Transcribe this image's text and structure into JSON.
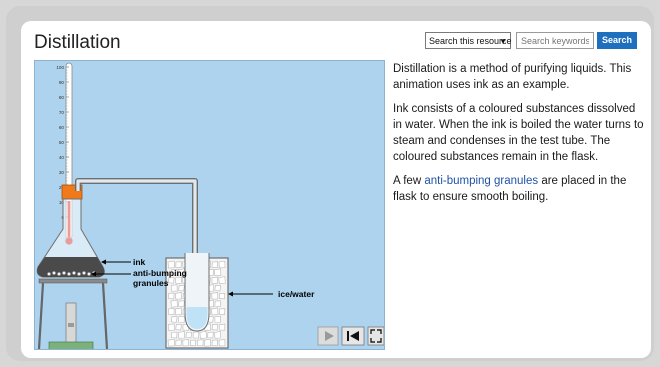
{
  "page": {
    "title": "Distillation"
  },
  "search": {
    "scope_label": "Search this resource",
    "placeholder": "Search keywords...",
    "button_label": "Search"
  },
  "animation": {
    "thermometer_ticks": [
      "100",
      "90",
      "80",
      "70",
      "60",
      "50",
      "40",
      "30",
      "20",
      "10",
      "0"
    ],
    "labels": {
      "ink": "ink",
      "granules_line1": "anti-bumping",
      "granules_line2": "granules",
      "ice_water": "ice/water"
    },
    "controls": [
      "play-icon",
      "rewind-icon",
      "fullscreen-icon"
    ]
  },
  "description": {
    "p1": "Distillation is a method of purifying liquids. This animation uses ink as an example.",
    "p2": "Ink consists of a coloured substances dissolved in water. When the ink is boiled the water turns to steam and condenses in the test tube. The coloured substances remain in the flask.",
    "p3_before": "A few ",
    "p3_link": "anti-bumping granules",
    "p3_after": " are placed in the flask to ensure smooth boiling."
  },
  "colors": {
    "accent": "#1f6fbf",
    "animation_bg": "#aed3ef",
    "link": "#1f53a6"
  }
}
